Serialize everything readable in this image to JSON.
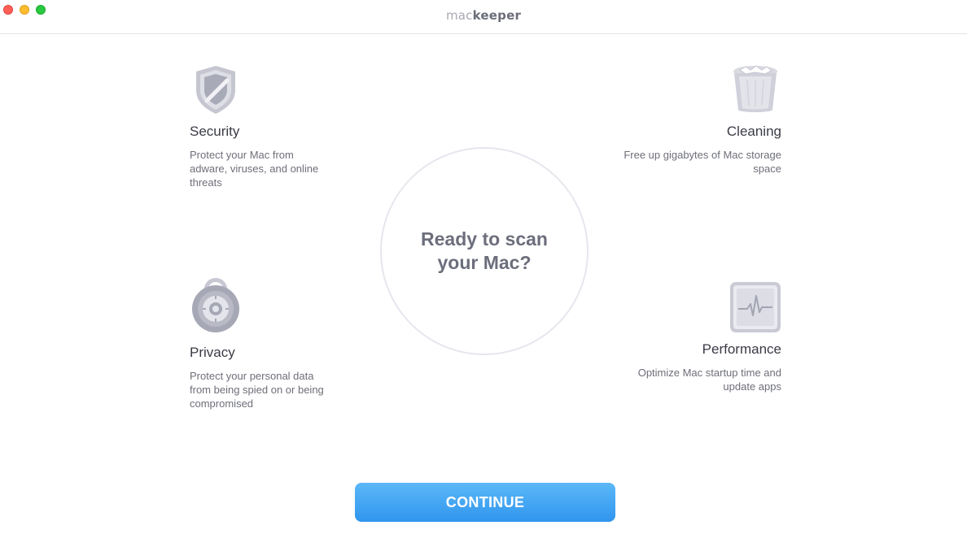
{
  "window": {
    "logo_part1": "mac",
    "logo_part2": "keeper"
  },
  "features": {
    "security": {
      "title": "Security",
      "description": "Protect your Mac from adware, viruses, and online threats",
      "icon": "shield-icon"
    },
    "cleaning": {
      "title": "Cleaning",
      "description": "Free up gigabytes of Mac storage space",
      "icon": "trash-bin-icon"
    },
    "privacy": {
      "title": "Privacy",
      "description": "Protect your personal data from being spied on or being compromised",
      "icon": "padlock-icon"
    },
    "performance": {
      "title": "Performance",
      "description": "Optimize Mac startup time and update apps",
      "icon": "activity-monitor-icon"
    }
  },
  "scan": {
    "text": "Ready to scan your Mac?"
  },
  "continue_button": {
    "label": "CONTINUE"
  },
  "colors": {
    "accent": "#3a9ef1",
    "title_text": "#3a3b45",
    "muted_text": "#6e6f79",
    "icon_gray": "#b7b8c4"
  }
}
